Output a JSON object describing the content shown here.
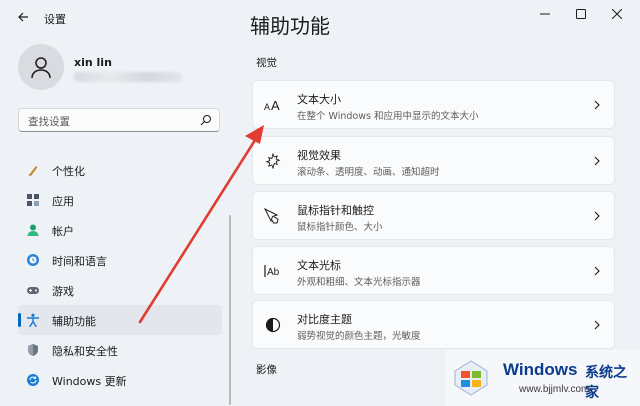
{
  "window": {
    "app_title": "设置",
    "controls": [
      "minimize",
      "maximize",
      "close"
    ]
  },
  "profile": {
    "name": "xin lin"
  },
  "search": {
    "placeholder": "查找设置"
  },
  "sidebar": {
    "items": [
      {
        "label": "个性化",
        "icon": "brush-icon",
        "active": false
      },
      {
        "label": "应用",
        "icon": "apps-icon",
        "active": false
      },
      {
        "label": "帐户",
        "icon": "account-icon",
        "active": false
      },
      {
        "label": "时间和语言",
        "icon": "time-language-icon",
        "active": false
      },
      {
        "label": "游戏",
        "icon": "gamepad-icon",
        "active": false
      },
      {
        "label": "辅助功能",
        "icon": "accessibility-icon",
        "active": true
      },
      {
        "label": "隐私和安全性",
        "icon": "shield-icon",
        "active": false
      },
      {
        "label": "Windows 更新",
        "icon": "update-icon",
        "active": false
      }
    ]
  },
  "main": {
    "title": "辅助功能",
    "section_vision": "视觉",
    "section_media": "影像",
    "cards": [
      {
        "title": "文本大小",
        "subtitle": "在整个 Windows 和应用中显示的文本大小",
        "icon": "text-size-icon"
      },
      {
        "title": "视觉效果",
        "subtitle": "滚动条、透明度、动画、通知超时",
        "icon": "visual-effects-icon"
      },
      {
        "title": "鼠标指针和触控",
        "subtitle": "鼠标指针颜色、大小",
        "icon": "mouse-pointer-icon"
      },
      {
        "title": "文本光标",
        "subtitle": "外观和粗细、文本光标指示器",
        "icon": "text-cursor-icon"
      },
      {
        "title": "对比度主题",
        "subtitle": "弱势视觉的颜色主题，光敏度",
        "icon": "contrast-icon"
      }
    ]
  },
  "watermark": {
    "brand": "Windows",
    "brand_cn": "系统之家",
    "url": "www.bjjmlv.com"
  },
  "colors": {
    "accent": "#0067c0",
    "annotation_arrow": "#e03c31"
  }
}
